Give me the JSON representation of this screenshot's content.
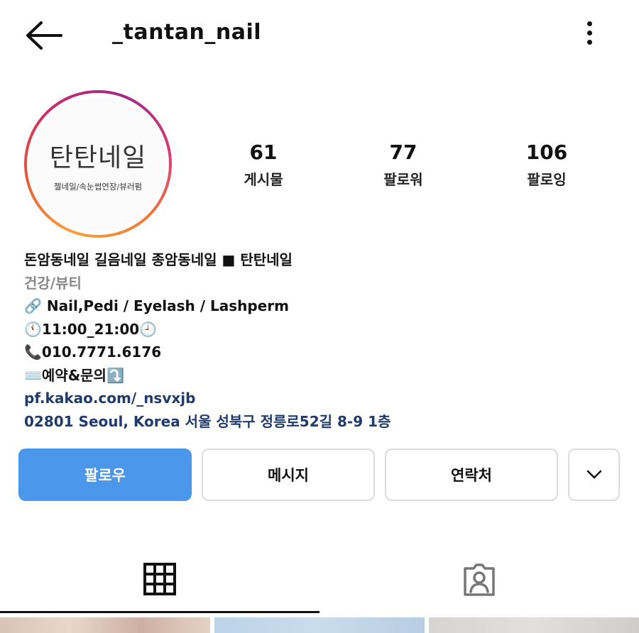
{
  "header": {
    "username": "_tantan_nail",
    "back_icon": "arrow-left-icon",
    "more_icon": "more-vertical-icon"
  },
  "avatar": {
    "title": "탄탄네일",
    "subtitle": "젤네일/속눈썹연장/뷰러펌"
  },
  "stats": [
    {
      "value": "61",
      "label": "게시물"
    },
    {
      "value": "77",
      "label": "팔로워"
    },
    {
      "value": "106",
      "label": "팔로잉"
    }
  ],
  "bio": {
    "name": "돈암동네일 길음네일 종암동네일 ■ 탄탄네일",
    "category": "건강/뷰티",
    "services": "🔗 Nail,Pedi / Eyelash / Lashperm",
    "hours": "🕚11:00_21:00🕘",
    "phone": "📞010.7771.6176",
    "reservation": "⌨️예약&문의⤵️",
    "link": "pf.kakao.com/_nsvxjb",
    "address": "02801 Seoul, Korea 서울 성북구 정릉로52길 8-9 1층"
  },
  "actions": {
    "follow": "팔로우",
    "message": "메시지",
    "contact": "연락처"
  },
  "tabs": {
    "grid_icon": "grid-icon",
    "tagged_icon": "tagged-person-icon"
  },
  "colors": {
    "follow_button": "#4a97ec",
    "link_text": "#1f3a6b",
    "category_text": "#888888"
  }
}
